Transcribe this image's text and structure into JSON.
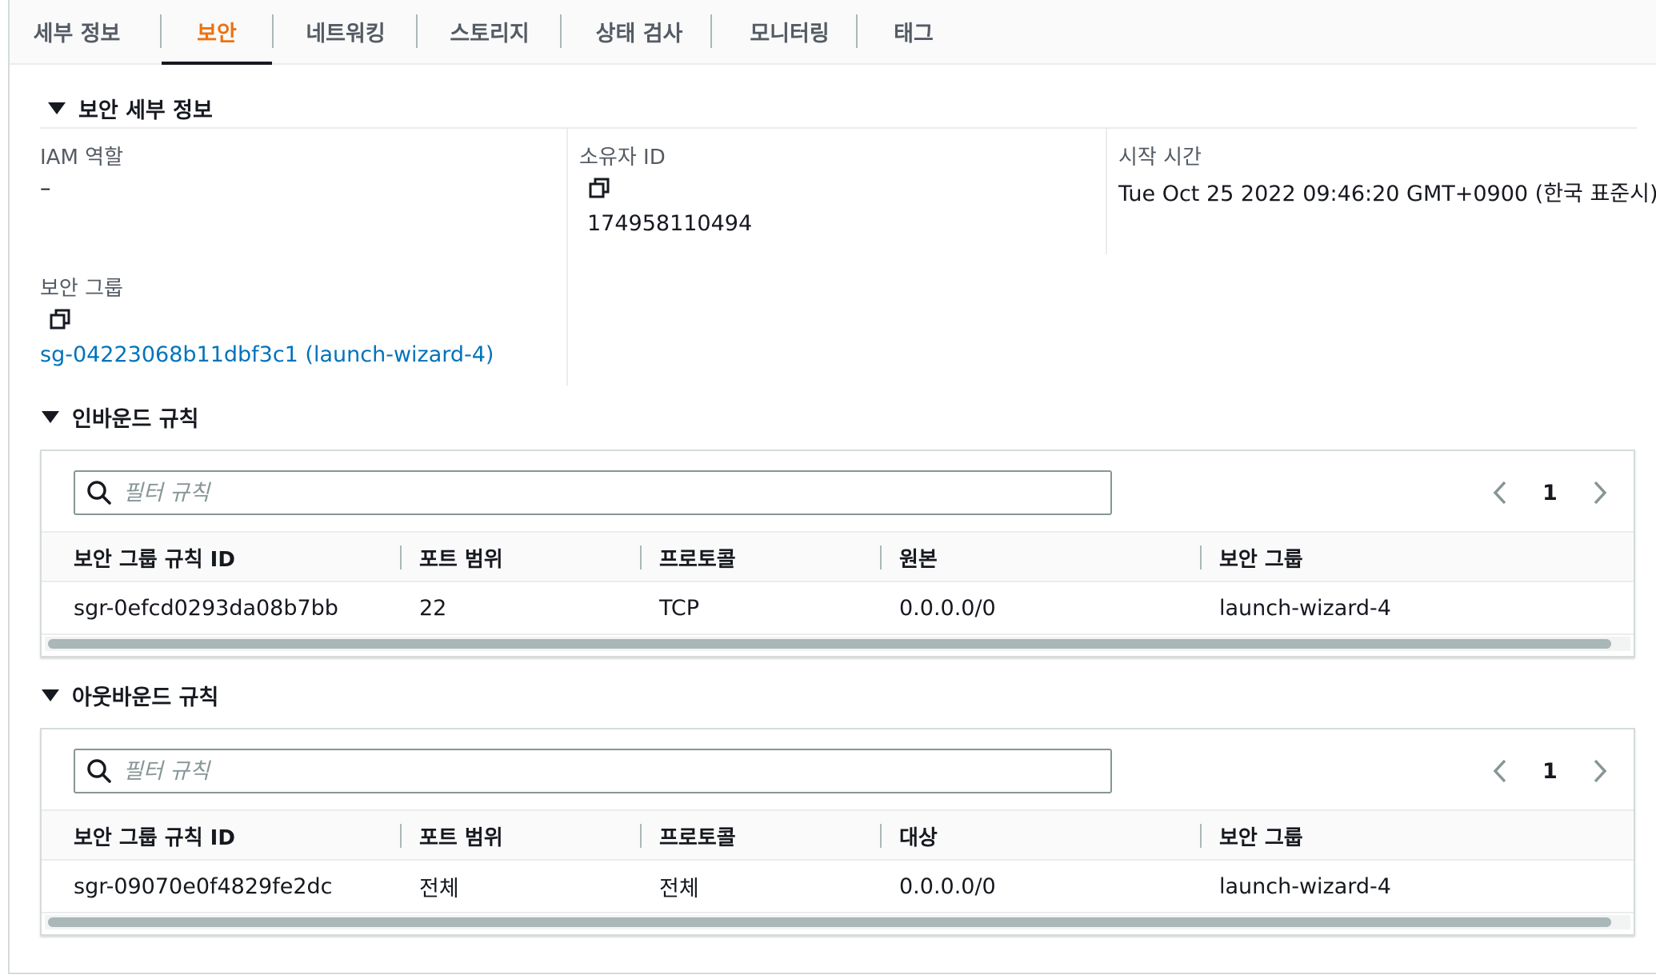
{
  "tabs": [
    {
      "label": "세부 정보",
      "active": false
    },
    {
      "label": "보안",
      "active": true
    },
    {
      "label": "네트워킹",
      "active": false
    },
    {
      "label": "스토리지",
      "active": false
    },
    {
      "label": "상태 검사",
      "active": false
    },
    {
      "label": "모니터링",
      "active": false
    },
    {
      "label": "태그",
      "active": false
    }
  ],
  "security_details": {
    "title": "보안 세부 정보",
    "iam_role": {
      "label": "IAM 역할",
      "value": "–"
    },
    "owner_id": {
      "label": "소유자 ID",
      "value": "174958110494"
    },
    "launch_time": {
      "label": "시작 시간",
      "value": "Tue Oct 25 2022 09:46:20 GMT+0900 (한국 표준시)"
    },
    "security_groups": {
      "label": "보안 그룹",
      "value": "sg-04223068b11dbf3c1 (launch-wizard-4)"
    }
  },
  "inbound": {
    "title": "인바운드 규칙",
    "search_placeholder": "필터 규칙",
    "page": "1",
    "columns": [
      "보안 그룹 규칙 ID",
      "포트 범위",
      "프로토콜",
      "원본",
      "보안 그룹"
    ],
    "rows": [
      [
        "sgr-0efcd0293da08b7bb",
        "22",
        "TCP",
        "0.0.0.0/0",
        "launch-wizard-4"
      ]
    ]
  },
  "outbound": {
    "title": "아웃바운드 규칙",
    "search_placeholder": "필터 규칙",
    "page": "1",
    "columns": [
      "보안 그룹 규칙 ID",
      "포트 범위",
      "프로토콜",
      "대상",
      "보안 그룹"
    ],
    "rows": [
      [
        "sgr-09070e0f4829fe2dc",
        "전체",
        "전체",
        "0.0.0.0/0",
        "launch-wizard-4"
      ]
    ]
  },
  "icons": {
    "copy": "copy-icon",
    "search": "search-icon",
    "prev": "chevron-left-icon",
    "next": "chevron-right-icon",
    "caret": "caret-down-icon"
  },
  "colors": {
    "active_tab": "#ec7211",
    "link": "#0073bb",
    "text": "#16191f",
    "label": "#545b64"
  }
}
